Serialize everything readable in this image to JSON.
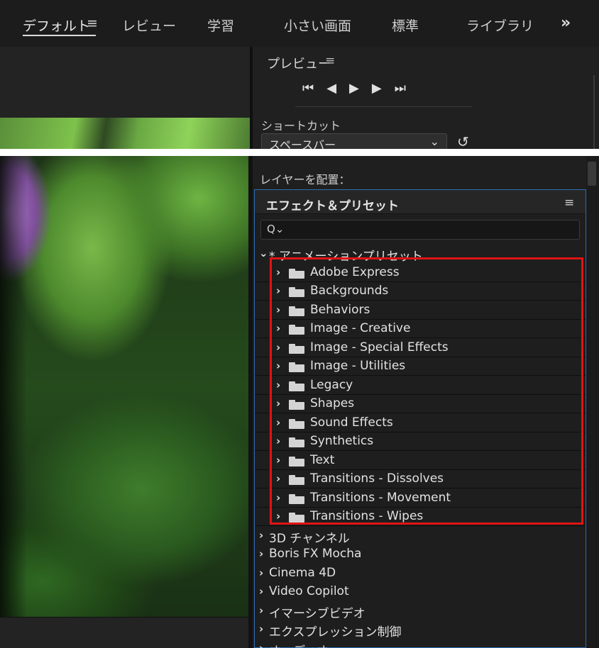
{
  "workspace_tabs": [
    {
      "label": "デフォルト",
      "active": true
    },
    {
      "label": "レビュー"
    },
    {
      "label": "学習"
    },
    {
      "label": "小さい画面"
    },
    {
      "label": "標準"
    },
    {
      "label": "ライブラリ"
    }
  ],
  "workspace_more": "»",
  "menu_glyph": "≡",
  "preview": {
    "title": "プレビュー",
    "controls": [
      "⏮",
      "◀",
      "▶",
      "▶",
      "⏭"
    ],
    "shortcut_label": "ショートカット",
    "shortcut_value": "スペースバー",
    "reset_icon": "↺"
  },
  "layer_place_label": "レイヤーを配置：",
  "effects": {
    "title": "エフェクト＆プリセット",
    "search_icon": "Q⌄",
    "root": {
      "label": "* アニメーションプリセット",
      "expanded": true
    },
    "preset_folders": [
      "Adobe Express",
      "Backgrounds",
      "Behaviors",
      "Image - Creative",
      "Image - Special Effects",
      "Image - Utilities",
      "Legacy",
      "Shapes",
      "Sound Effects",
      "Synthetics",
      "Text",
      "Transitions - Dissolves",
      "Transitions - Movement",
      "Transitions - Wipes"
    ],
    "categories": [
      "3D チャンネル",
      "Boris FX Mocha",
      "Cinema 4D",
      "Video Copilot",
      "イマーシブビデオ",
      "エクスプレッション制御",
      "オーディオ"
    ]
  },
  "colors": {
    "panel_bg": "#1e1e1e",
    "panel_border": "#2d6db5",
    "highlight": "#e01414"
  }
}
